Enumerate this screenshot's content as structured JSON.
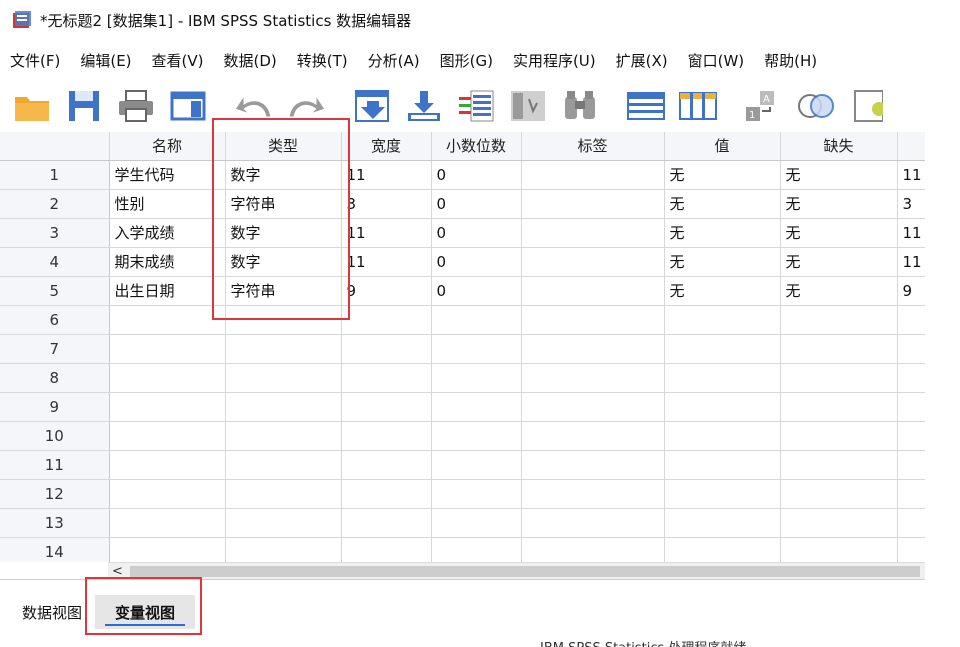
{
  "window": {
    "title": "*无标题2 [数据集1] - IBM SPSS Statistics 数据编辑器"
  },
  "menubar": {
    "items": [
      {
        "label": "文件(F)"
      },
      {
        "label": "编辑(E)"
      },
      {
        "label": "查看(V)"
      },
      {
        "label": "数据(D)"
      },
      {
        "label": "转换(T)"
      },
      {
        "label": "分析(A)"
      },
      {
        "label": "图形(G)"
      },
      {
        "label": "实用程序(U)"
      },
      {
        "label": "扩展(X)"
      },
      {
        "label": "窗口(W)"
      },
      {
        "label": "帮助(H)"
      }
    ]
  },
  "toolbar": {
    "icons": [
      "open-folder-icon",
      "save-icon",
      "print-icon",
      "dialog-recall-icon",
      "undo-icon",
      "redo-icon",
      "goto-case-icon",
      "goto-variable-icon",
      "variables-icon",
      "run-descriptives-icon",
      "find-icon",
      "insert-cases-icon",
      "insert-variable-icon",
      "split-file-icon",
      "weight-cases-icon",
      "select-cases-icon"
    ]
  },
  "grid": {
    "columns": [
      "",
      "名称",
      "类型",
      "宽度",
      "小数位数",
      "标签",
      "值",
      "缺失",
      ""
    ],
    "rows": [
      {
        "num": "1",
        "name": "学生代码",
        "type": "数字",
        "width": "11",
        "decimals": "0",
        "label": "",
        "values": "无",
        "missing": "无",
        "columns": "11"
      },
      {
        "num": "2",
        "name": "性别",
        "type": "字符串",
        "width": "3",
        "decimals": "0",
        "label": "",
        "values": "无",
        "missing": "无",
        "columns": "3"
      },
      {
        "num": "3",
        "name": "入学成绩",
        "type": "数字",
        "width": "11",
        "decimals": "0",
        "label": "",
        "values": "无",
        "missing": "无",
        "columns": "11"
      },
      {
        "num": "4",
        "name": "期末成绩",
        "type": "数字",
        "width": "11",
        "decimals": "0",
        "label": "",
        "values": "无",
        "missing": "无",
        "columns": "11"
      },
      {
        "num": "5",
        "name": "出生日期",
        "type": "字符串",
        "width": "9",
        "decimals": "0",
        "label": "",
        "values": "无",
        "missing": "无",
        "columns": "9"
      }
    ],
    "empty_rows": [
      "6",
      "7",
      "8",
      "9",
      "10",
      "11",
      "12",
      "13",
      "14"
    ]
  },
  "scrollbar": {
    "left_arrow": "<"
  },
  "tabs": {
    "data_view": "数据视图",
    "variable_view": "变量视图"
  },
  "status": {
    "text": "IBM SPSS Statistics 处理程序就绪"
  },
  "colors": {
    "highlight": "#e0353c",
    "header_bg": "#f4f6f9",
    "active_tab_underline": "#2b6cd6"
  }
}
